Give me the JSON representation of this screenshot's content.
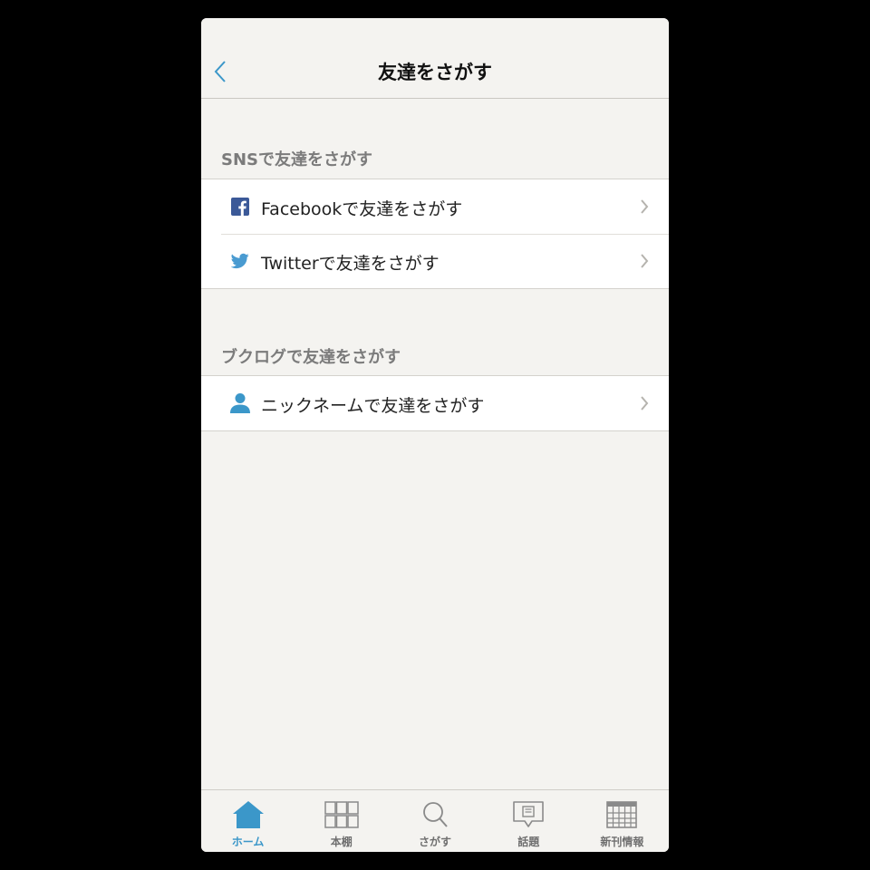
{
  "colors": {
    "accent": "#3b97c9",
    "background": "#f4f3f0",
    "facebook": "#3b5998",
    "twitter": "#4a9bd1"
  },
  "navbar": {
    "title": "友達をさがす",
    "back_icon": "chevron-left-icon"
  },
  "sections": [
    {
      "header": "SNSで友達をさがす",
      "items": [
        {
          "icon": "facebook-icon",
          "label": "Facebookで友達をさがす"
        },
        {
          "icon": "twitter-icon",
          "label": "Twitterで友達をさがす"
        }
      ]
    },
    {
      "header": "ブクログで友達をさがす",
      "items": [
        {
          "icon": "user-icon",
          "label": "ニックネームで友達をさがす"
        }
      ]
    }
  ],
  "tabbar": {
    "active": "ホーム",
    "tabs": [
      {
        "icon": "home-icon",
        "label": "ホーム"
      },
      {
        "icon": "bookshelf-icon",
        "label": "本棚"
      },
      {
        "icon": "search-icon",
        "label": "さがす"
      },
      {
        "icon": "speech-bubble-icon",
        "label": "話題"
      },
      {
        "icon": "calendar-icon",
        "label": "新刊情報"
      }
    ]
  }
}
